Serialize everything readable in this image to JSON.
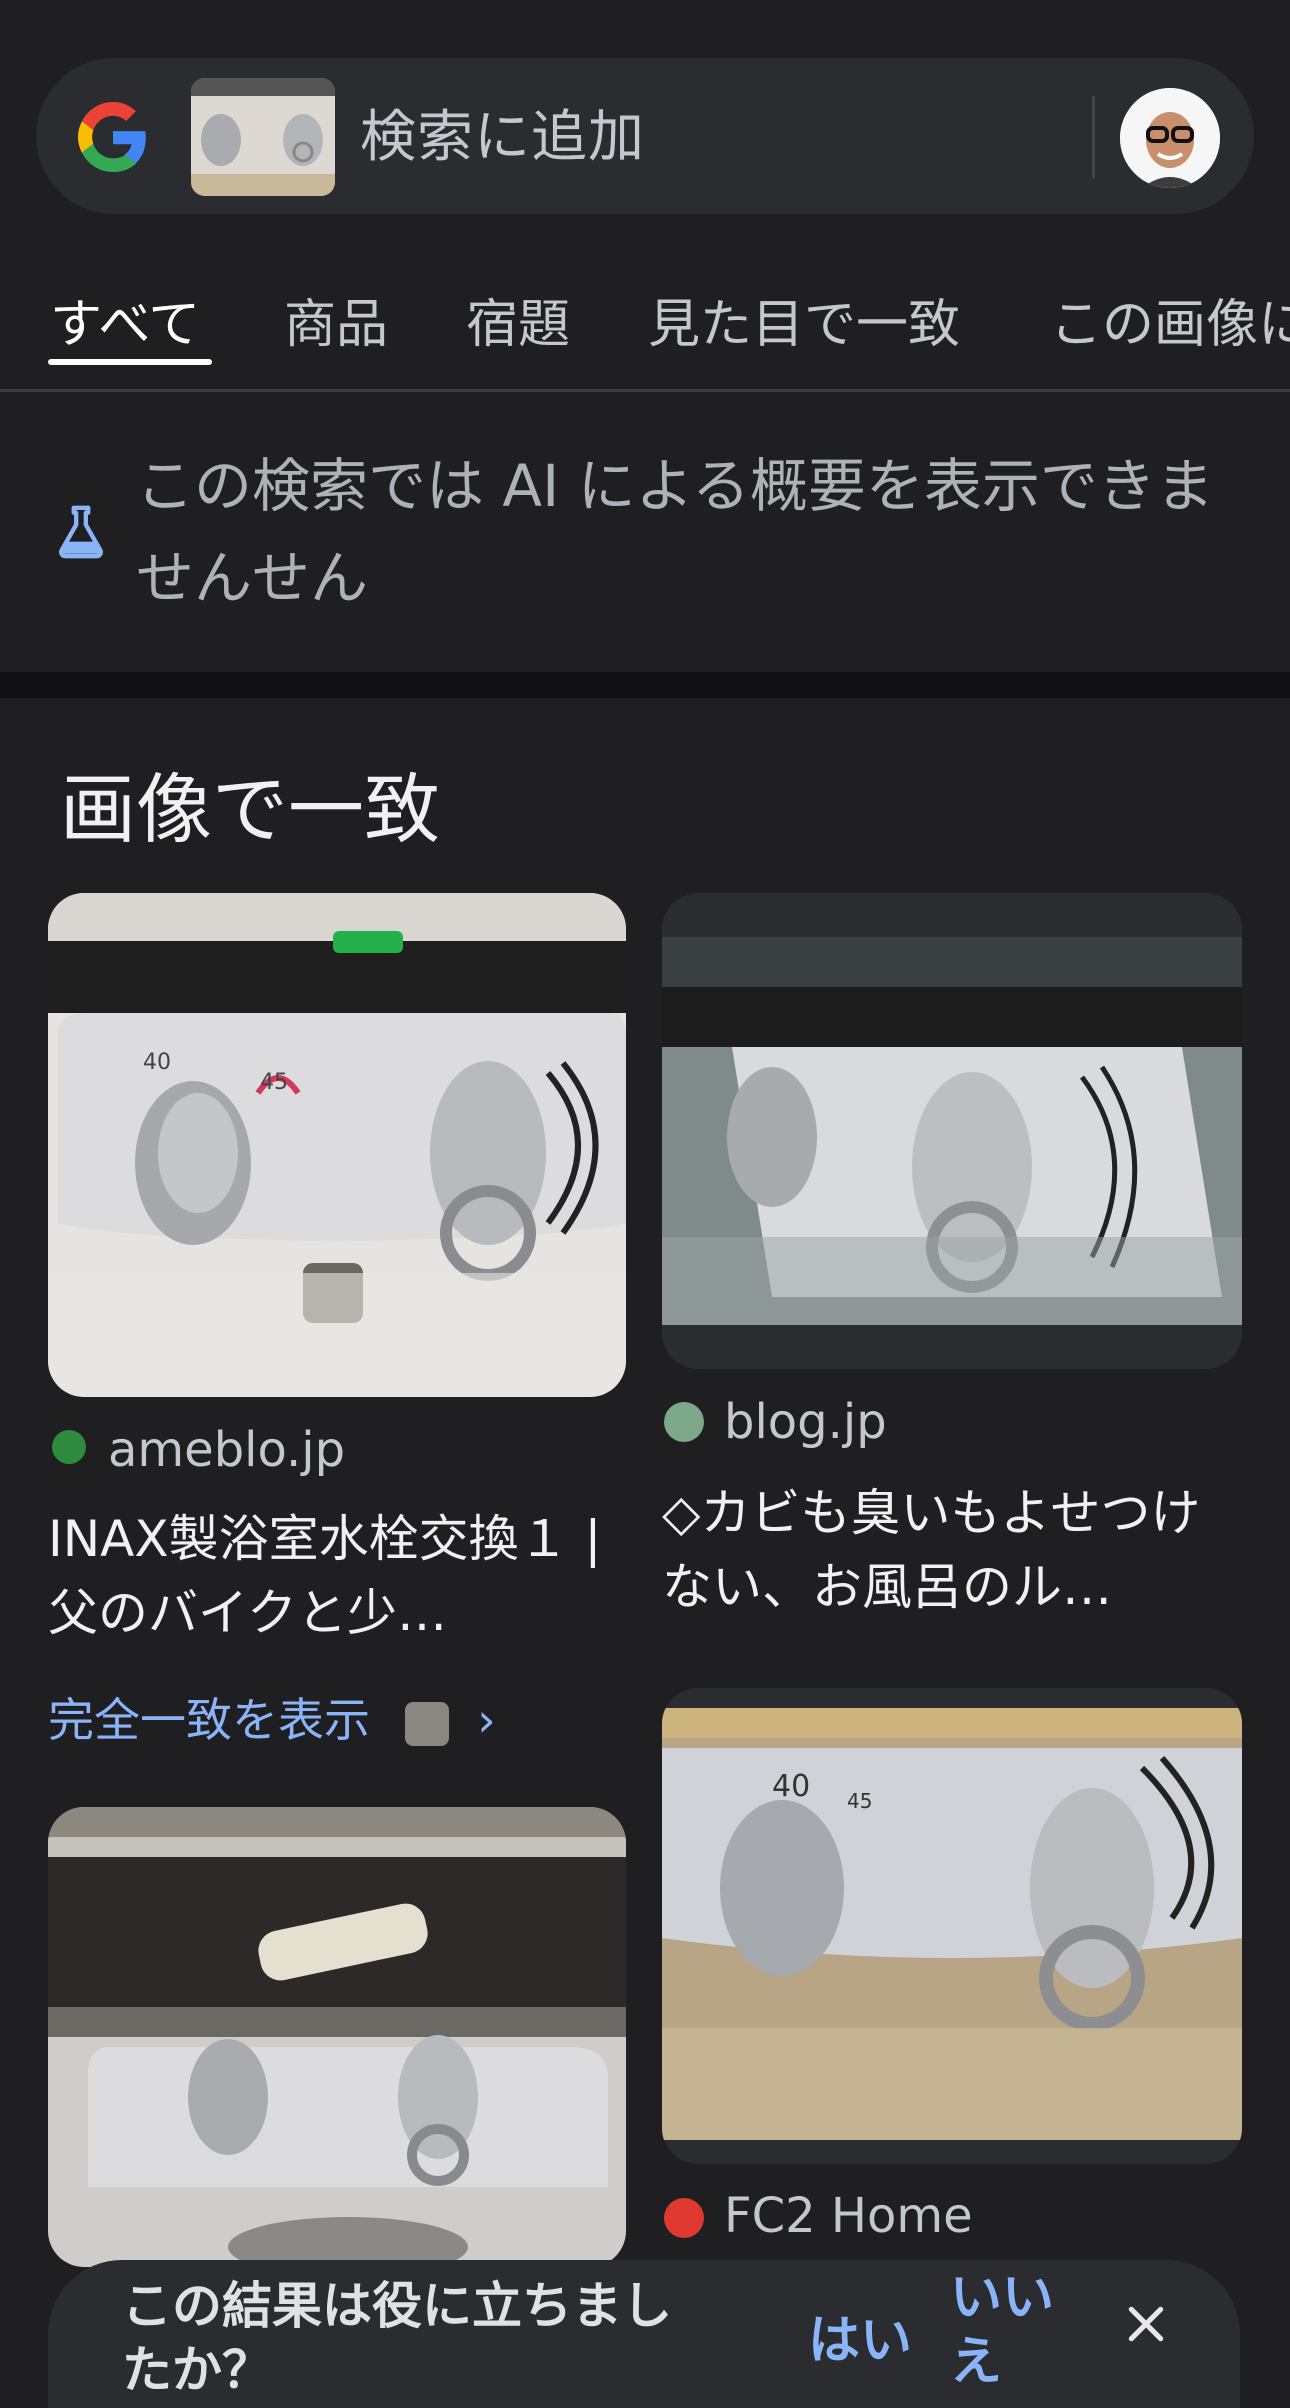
{
  "search": {
    "placeholder": "検索に追加",
    "thumbnail_icon": "faucet-thumbnail",
    "avatar_icon": "user-avatar"
  },
  "tabs": [
    {
      "label": "すべて",
      "active": true
    },
    {
      "label": "商品"
    },
    {
      "label": "宿題"
    },
    {
      "label": "見た目で一致"
    },
    {
      "label": "この画像に"
    }
  ],
  "ai_notice": {
    "text": "この検索では AI による概要を表示できませんせん",
    "icon": "flask-icon"
  },
  "section": {
    "title": "画像で一致"
  },
  "results": [
    {
      "source": "ameblo.jp",
      "title": "INAX製浴室水栓交換１ | 父のバイクと少…",
      "favicon": "ameblo-favicon"
    },
    {
      "source": "blog.jp",
      "title": "◇カビも臭いもよせつけない、お風呂のル…",
      "favicon": "blog-favicon"
    },
    {
      "source": "",
      "title": "",
      "favicon": ""
    },
    {
      "source": "FC2 Home",
      "title": "",
      "favicon": "fc2-favicon"
    }
  ],
  "exact_match_link": {
    "label": "完全一致を表示",
    "chevron": "›"
  },
  "feedback": {
    "question": "この結果は役に立ちましたか？",
    "yes": "はい",
    "no": "いいえ"
  },
  "colors": {
    "background": "#1f1f21",
    "surface": "#2b2c30",
    "link": "#8ab4f8",
    "text": "#f1f1f3"
  }
}
